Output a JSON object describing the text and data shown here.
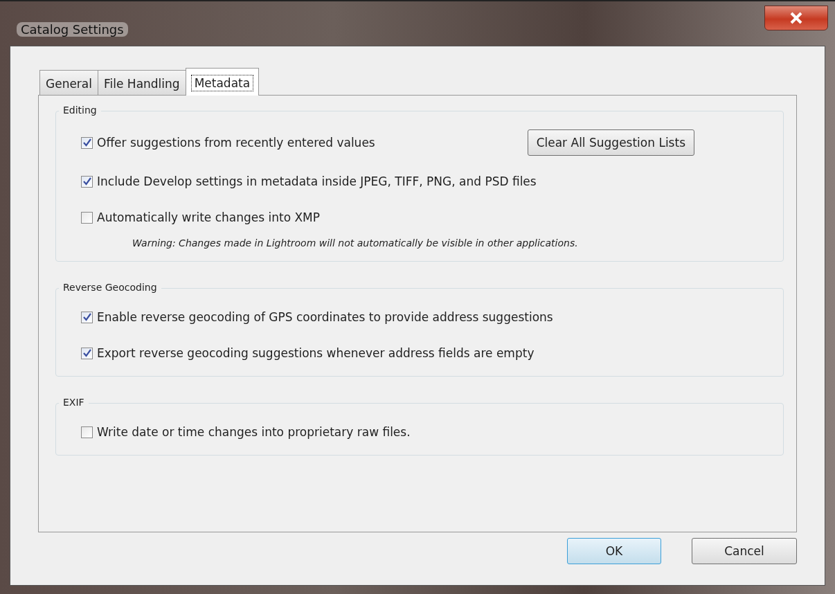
{
  "window": {
    "title": "Catalog Settings"
  },
  "tabs": [
    {
      "label": "General",
      "selected": false
    },
    {
      "label": "File Handling",
      "selected": false
    },
    {
      "label": "Metadata",
      "selected": true
    }
  ],
  "sections": [
    {
      "title": "Editing",
      "button": "Clear All Suggestion Lists",
      "items": [
        {
          "kind": "checkbox",
          "label": "Offer suggestions from recently entered values",
          "checked": true
        },
        {
          "kind": "checkbox",
          "label": "Include Develop settings in metadata inside JPEG, TIFF, PNG, and PSD files",
          "checked": true
        },
        {
          "kind": "checkbox",
          "label": "Automatically write changes into XMP",
          "checked": false
        },
        {
          "kind": "note",
          "label": "Warning: Changes made in Lightroom will not automatically be visible in other applications."
        }
      ]
    },
    {
      "title": "Reverse Geocoding",
      "items": [
        {
          "kind": "checkbox",
          "label": "Enable reverse geocoding of GPS coordinates to provide address suggestions",
          "checked": true
        },
        {
          "kind": "checkbox",
          "label": "Export reverse geocoding suggestions whenever address fields are empty",
          "checked": true
        }
      ]
    },
    {
      "title": "EXIF",
      "items": [
        {
          "kind": "checkbox",
          "label": "Write date or time changes into proprietary raw files.",
          "checked": false
        }
      ]
    }
  ],
  "buttons": [
    {
      "label": "OK",
      "default": true
    },
    {
      "label": "Cancel",
      "default": false
    }
  ]
}
